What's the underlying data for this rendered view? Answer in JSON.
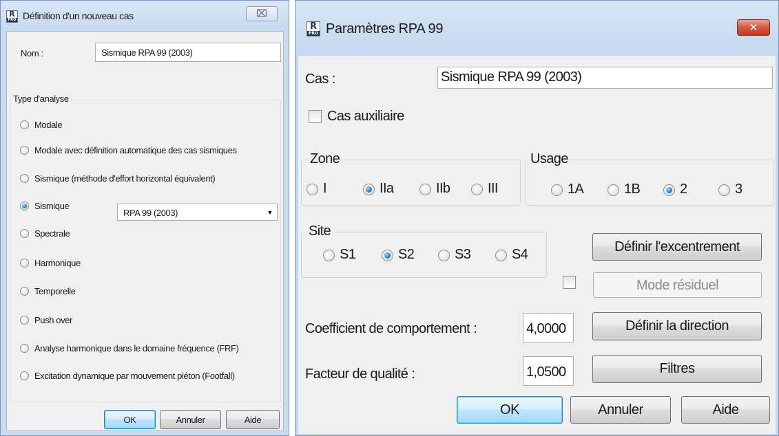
{
  "left_dialog": {
    "title": "Définition d'un nouveau cas",
    "close_label": "⌧",
    "name_label": "Nom :",
    "name_value": "Sismique RPA 99 (2003)",
    "analysis_group_label": "Type d'analyse",
    "analysis_options": [
      {
        "label": "Modale",
        "selected": false
      },
      {
        "label": "Modale avec définition automatique des cas sismiques",
        "selected": false
      },
      {
        "label": "Sismique (méthode d'effort horizontal équivalent)",
        "selected": false
      },
      {
        "label": "Sismique",
        "selected": true
      },
      {
        "label": "Spectrale",
        "selected": false
      },
      {
        "label": "Harmonique",
        "selected": false
      },
      {
        "label": "Temporelle",
        "selected": false
      },
      {
        "label": "Push over",
        "selected": false
      },
      {
        "label": "Analyse harmonique dans le domaine fréquence (FRF)",
        "selected": false
      },
      {
        "label": "Excitation dynamique par mouvement piéton (Footfall)",
        "selected": false
      }
    ],
    "seismic_standard_value": "RPA 99 (2003)",
    "ok_label": "OK",
    "cancel_label": "Annuler",
    "help_label": "Aide"
  },
  "right_dialog": {
    "title": "Paramètres RPA 99",
    "close_label": "✕",
    "case_label": "Cas :",
    "case_value": "Sismique RPA 99 (2003)",
    "auxiliary_label": "Cas auxiliaire",
    "auxiliary_checked": false,
    "zone": {
      "label": "Zone",
      "options": [
        {
          "label": "I",
          "selected": false
        },
        {
          "label": "IIa",
          "selected": true
        },
        {
          "label": "IIb",
          "selected": false
        },
        {
          "label": "III",
          "selected": false
        }
      ]
    },
    "usage": {
      "label": "Usage",
      "options": [
        {
          "label": "1A",
          "selected": false
        },
        {
          "label": "1B",
          "selected": false
        },
        {
          "label": "2",
          "selected": true
        },
        {
          "label": "3",
          "selected": false
        }
      ]
    },
    "site": {
      "label": "Site",
      "options": [
        {
          "label": "S1",
          "selected": false
        },
        {
          "label": "S2",
          "selected": true
        },
        {
          "label": "S3",
          "selected": false
        },
        {
          "label": "S4",
          "selected": false
        }
      ]
    },
    "eccentricity_button": "Définir l'excentrement",
    "residual_mode_checked": false,
    "residual_mode_button": "Mode résiduel",
    "behavior_coef_label": "Coefficient de comportement :",
    "behavior_coef_value": "4,0000",
    "direction_button": "Définir la direction",
    "quality_factor_label": "Facteur de qualité :",
    "quality_factor_value": "1,0500",
    "filters_button": "Filtres",
    "ok_label": "OK",
    "cancel_label": "Annuler",
    "help_label": "Aide"
  }
}
